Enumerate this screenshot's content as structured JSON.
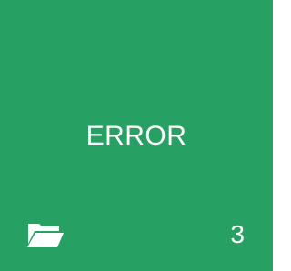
{
  "tile": {
    "label": "ERROR",
    "count": "3",
    "icon": "folder-open-icon",
    "background_color": "#26a063",
    "text_color": "#ffffff"
  }
}
